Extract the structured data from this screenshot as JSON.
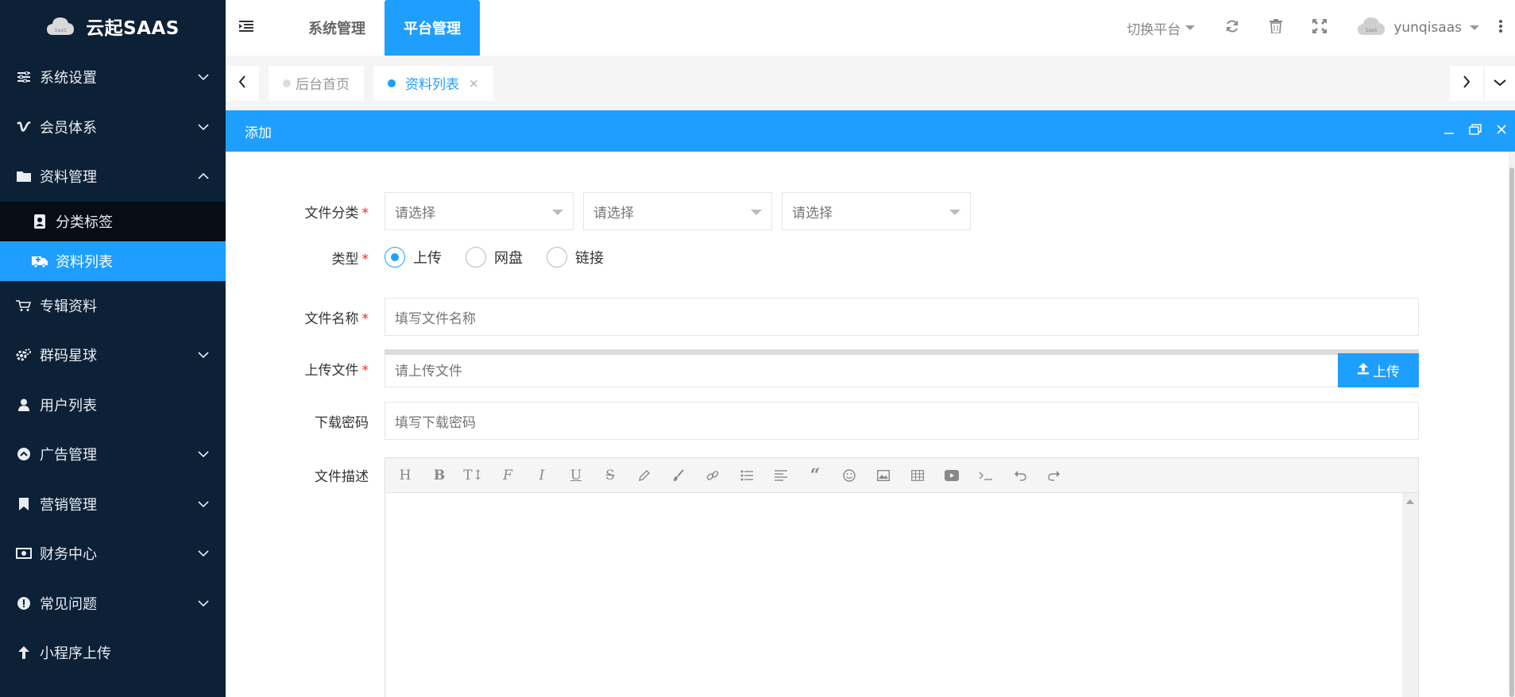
{
  "app": {
    "title": "云起SAAS"
  },
  "sidebar": {
    "items": [
      {
        "label": "系统设置",
        "icon": "sliders-icon",
        "expandable": true
      },
      {
        "label": "会员体系",
        "icon": "vimeo-icon",
        "expandable": true
      },
      {
        "label": "资料管理",
        "icon": "folder-icon",
        "expandable": true,
        "expanded": true,
        "children": [
          {
            "label": "分类标签",
            "icon": "contact-book-icon",
            "active": false
          },
          {
            "label": "资料列表",
            "icon": "ambulance-icon",
            "active": true
          }
        ]
      },
      {
        "label": "专辑资料",
        "icon": "cart-icon",
        "expandable": false
      },
      {
        "label": "群码星球",
        "icon": "cogs-icon",
        "expandable": true
      },
      {
        "label": "用户列表",
        "icon": "user-icon",
        "expandable": false
      },
      {
        "label": "广告管理",
        "icon": "chevron-circle-up-icon",
        "expandable": true
      },
      {
        "label": "营销管理",
        "icon": "bookmark-icon",
        "expandable": true
      },
      {
        "label": "财务中心",
        "icon": "money-icon",
        "expandable": true
      },
      {
        "label": "常见问题",
        "icon": "exclamation-circle-icon",
        "expandable": true
      },
      {
        "label": "小程序上传",
        "icon": "arrow-up-icon",
        "expandable": false
      }
    ]
  },
  "topbar": {
    "nav": [
      {
        "label": "系统管理",
        "active": false
      },
      {
        "label": "平台管理",
        "active": true
      }
    ],
    "switch_platform": "切换平台",
    "username": "yunqisaas"
  },
  "tabs": [
    {
      "label": "后台首页",
      "active": false,
      "closable": false
    },
    {
      "label": "资料列表",
      "active": true,
      "closable": true,
      "close_glyph": "×"
    }
  ],
  "dialog": {
    "title": "添加",
    "form": {
      "category_label": "文件分类",
      "category_selects": [
        "请选择",
        "请选择",
        "请选择"
      ],
      "type_label": "类型",
      "type_options": [
        {
          "label": "上传",
          "checked": true
        },
        {
          "label": "网盘",
          "checked": false
        },
        {
          "label": "链接",
          "checked": false
        }
      ],
      "name_label": "文件名称",
      "name_placeholder": "填写文件名称",
      "upload_label": "上传文件",
      "upload_placeholder": "请上传文件",
      "upload_button": "上传",
      "password_label": "下载密码",
      "password_placeholder": "填写下载密码",
      "desc_label": "文件描述",
      "required_mark": "*"
    },
    "editor_tools": [
      "H",
      "B",
      "T↕",
      "F",
      "I",
      "U",
      "S",
      "pencil",
      "brush",
      "link",
      "list",
      "align",
      "quote",
      "emoji",
      "image",
      "table",
      "video",
      "code",
      "undo",
      "redo"
    ]
  },
  "colors": {
    "sidebar_bg": "#0c2036",
    "accent": "#1e9fff",
    "required": "#ff2222"
  }
}
